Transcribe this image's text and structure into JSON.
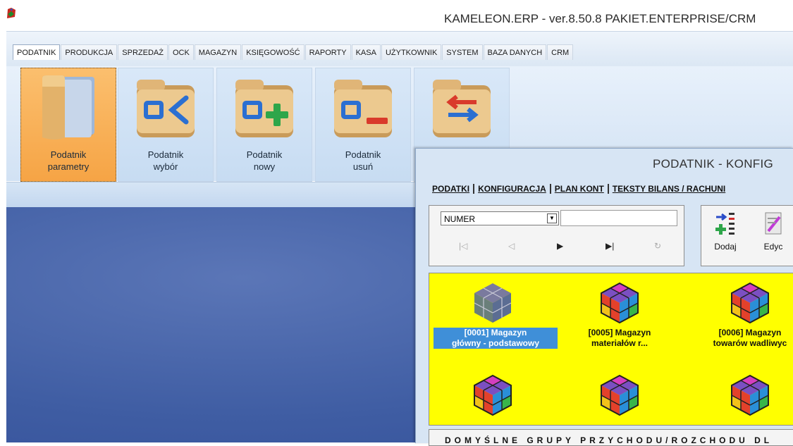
{
  "window": {
    "title": "KAMELEON.ERP - ver.8.50.8 PAKIET.ENTERPRISE/CRM"
  },
  "menu_tabs": [
    "PODATNIK",
    "PRODUKCJA",
    "SPRZEDAŻ",
    "OCK",
    "MAGAZYN",
    "KSIĘGOWOŚĆ",
    "RAPORTY",
    "KASA",
    "UŻYTKOWNIK",
    "SYSTEM",
    "BAZA DANYCH",
    "CRM"
  ],
  "active_tab": "PODATNIK",
  "ribbon": {
    "buttons": [
      {
        "line1": "Podatnik",
        "line2": "parametry",
        "icon": "folder-icon",
        "active": true
      },
      {
        "line1": "Podatnik",
        "line2": "wybór",
        "icon": "folder-select-icon"
      },
      {
        "line1": "Podatnik",
        "line2": "nowy",
        "icon": "folder-add-icon"
      },
      {
        "line1": "Podatnik",
        "line2": "usuń",
        "icon": "folder-remove-icon"
      },
      {
        "line1": "",
        "line2": "",
        "icon": "folder-switch-icon"
      }
    ]
  },
  "child_window": {
    "title": "PODATNIK  - KONFIG",
    "tabs": [
      "PODATKI",
      "KONFIGURACJA",
      "PLAN KONT",
      "TEKSTY BILANS / RACHUNI"
    ],
    "nav": {
      "field_select": "NUMER",
      "search_value": "",
      "buttons": [
        "first",
        "prev",
        "next",
        "last",
        "refresh"
      ]
    },
    "actions": [
      {
        "label": "Dodaj",
        "icon": "add-list-icon"
      },
      {
        "label": "Edyc",
        "icon": "edit-icon"
      }
    ],
    "items": [
      {
        "line1": "[0001] Magazyn",
        "line2": "główny - podstawowy",
        "selected": true
      },
      {
        "line1": "[0005] Magazyn",
        "line2": "materiałów r..."
      },
      {
        "line1": "[0006] Magazyn",
        "line2": "towarów wadliwyc"
      },
      {
        "line1": "",
        "line2": ""
      },
      {
        "line1": "",
        "line2": ""
      },
      {
        "line1": "",
        "line2": ""
      }
    ],
    "bottom_label": "DOMYŚLNE GRUPY PRZYCHODU/ROZCHODU DL"
  },
  "colors": {
    "grid_background": "#ffff00",
    "selection": "#3f8fd8",
    "active_ribbon": "#f9b15a",
    "desktop": "#4663a7"
  }
}
